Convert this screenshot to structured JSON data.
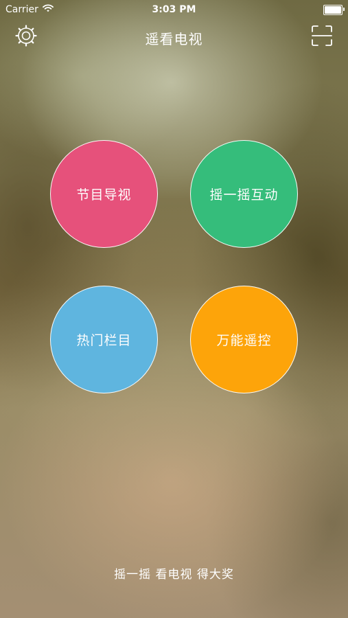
{
  "status_bar": {
    "carrier": "Carrier",
    "time": "3:03 PM",
    "battery_level": 1
  },
  "nav": {
    "title": "遥看电视",
    "settings_icon": "gear-icon",
    "scan_icon": "scan-icon"
  },
  "menu": {
    "guide": {
      "label": "节目导视",
      "color": "#e6517b"
    },
    "shake": {
      "label": "摇一摇互动",
      "color": "#35bd7b"
    },
    "hot": {
      "label": "热门栏目",
      "color": "#5fb5df"
    },
    "remote": {
      "label": "万能遥控",
      "color": "#fda40a"
    }
  },
  "footer": {
    "slogan": "摇一摇 看电视 得大奖"
  }
}
